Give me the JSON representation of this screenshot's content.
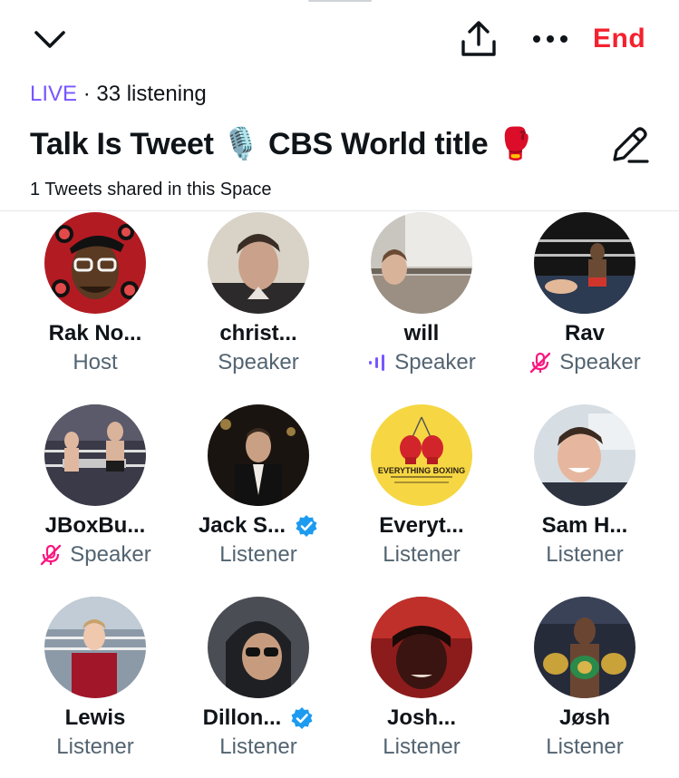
{
  "header": {
    "end_label": "End",
    "live_label": "LIVE",
    "separator": " · ",
    "listening_text": "33 listening",
    "title": "Talk Is Tweet 🎙️ CBS World title 🥊",
    "shared_text": "1 Tweets shared in this Space"
  },
  "icons": {
    "collapse": "chevron-down-icon",
    "share": "share-icon",
    "more": "more-dots-icon",
    "edit": "edit-pencil-icon",
    "verified": "verified-badge-icon",
    "muted": "mic-muted-icon",
    "speaking": "speaking-bars-icon"
  },
  "colors": {
    "live": "#7856ff",
    "end": "#f4212e",
    "muted": "#f91880",
    "verified": "#1d9bf0",
    "secondary_text": "#536471"
  },
  "participants": [
    {
      "name": "Rak No...",
      "role": "Host",
      "status": "none",
      "verified": false
    },
    {
      "name": "christ...",
      "role": "Speaker",
      "status": "none",
      "verified": false
    },
    {
      "name": "will",
      "role": "Speaker",
      "status": "speaking",
      "verified": false
    },
    {
      "name": "Rav",
      "role": "Speaker",
      "status": "muted",
      "verified": false
    },
    {
      "name": "JBoxBu...",
      "role": "Speaker",
      "status": "muted",
      "verified": false
    },
    {
      "name": "Jack S...",
      "role": "Listener",
      "status": "none",
      "verified": true
    },
    {
      "name": "Everyt...",
      "role": "Listener",
      "status": "none",
      "verified": false,
      "avatar_text": "EVERYTHING BOXING"
    },
    {
      "name": "Sam H...",
      "role": "Listener",
      "status": "none",
      "verified": false
    },
    {
      "name": "Lewis",
      "role": "Listener",
      "status": "none",
      "verified": false
    },
    {
      "name": "Dillon...",
      "role": "Listener",
      "status": "none",
      "verified": true
    },
    {
      "name": "Josh...",
      "role": "Listener",
      "status": "none",
      "verified": false
    },
    {
      "name": "Jøsh",
      "role": "Listener",
      "status": "none",
      "verified": false
    }
  ]
}
